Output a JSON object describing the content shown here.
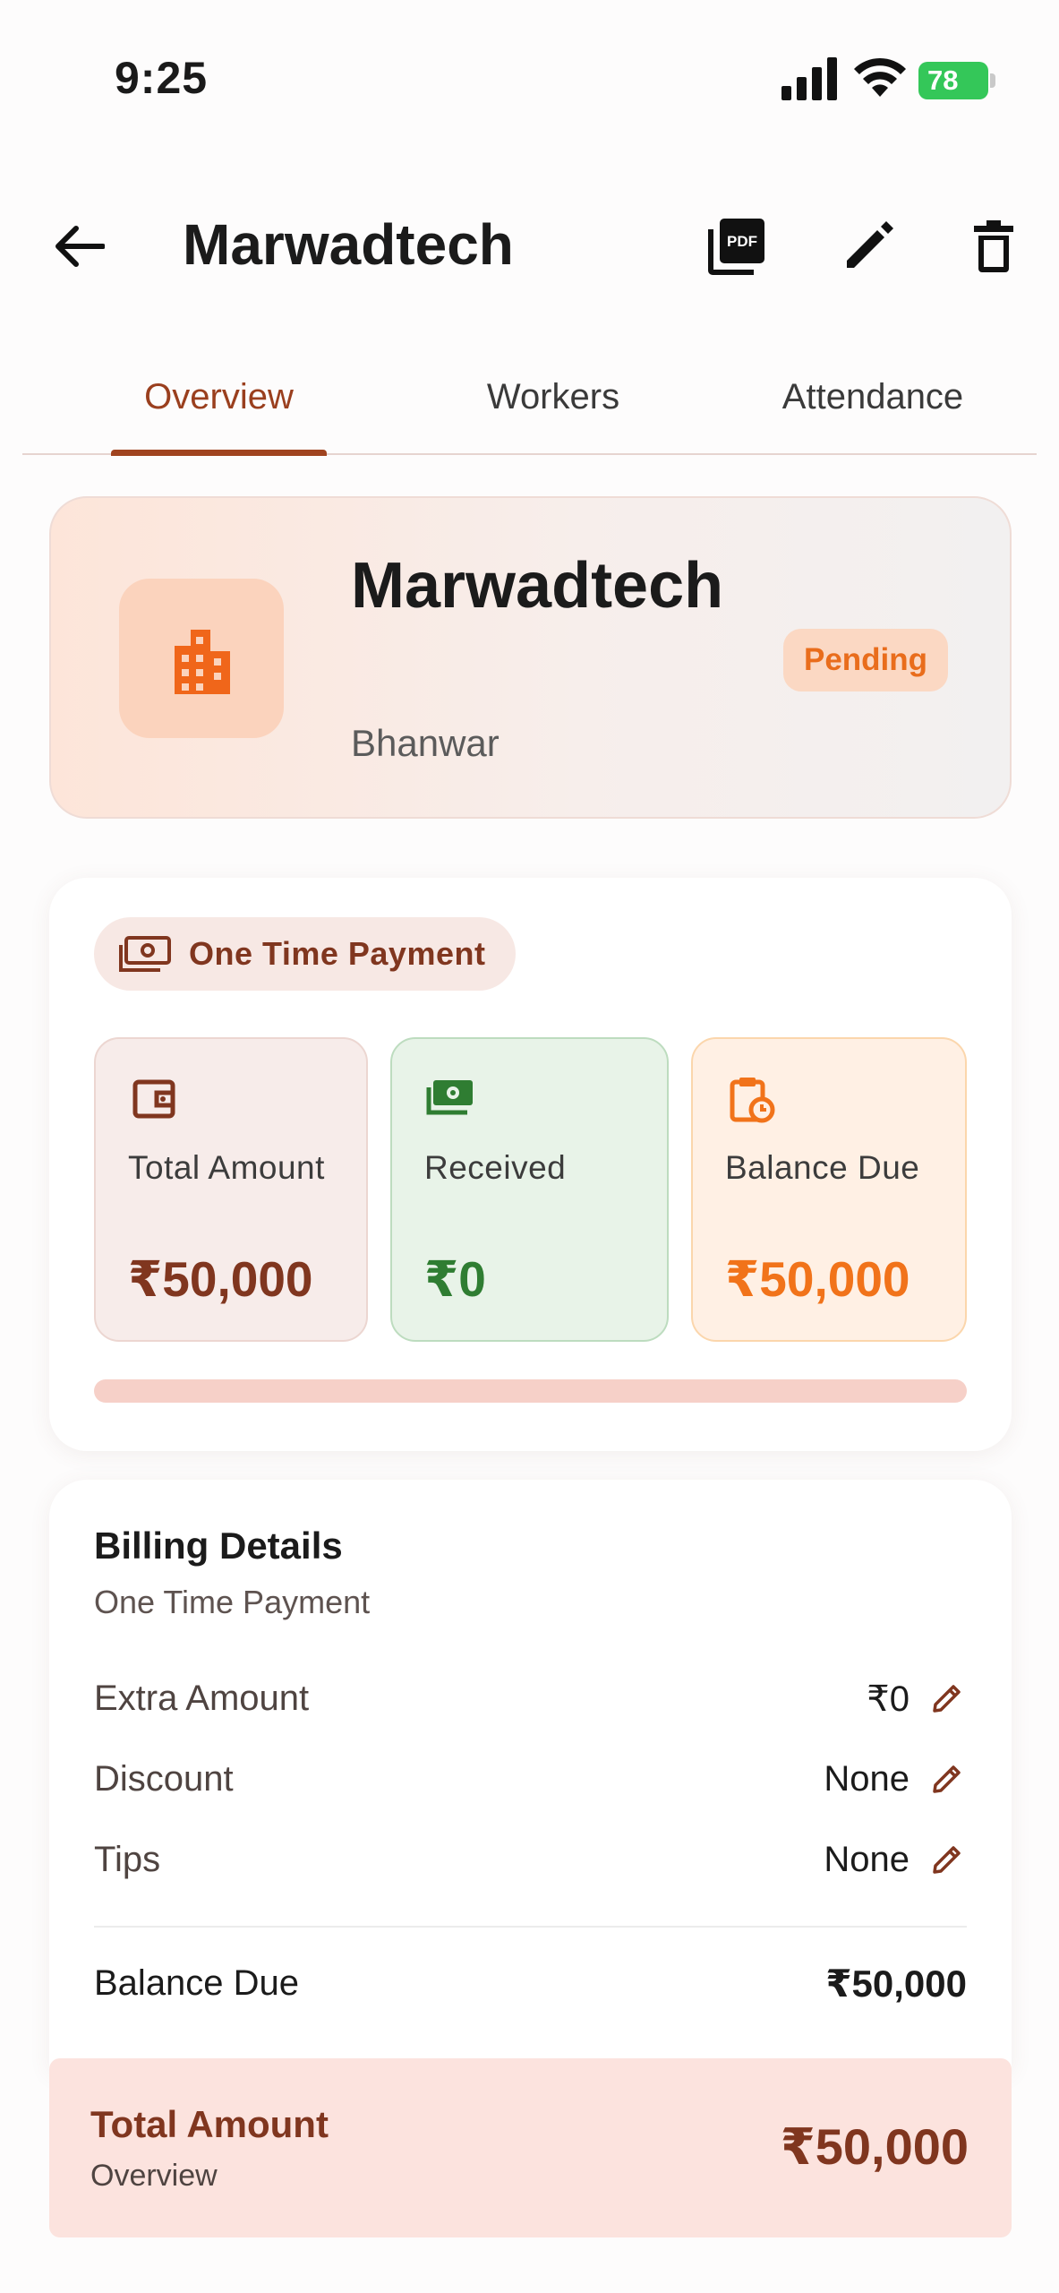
{
  "status_bar": {
    "time": "9:25",
    "battery": "78",
    "icons": [
      "signal-icon",
      "wifi-icon",
      "battery-icon"
    ]
  },
  "app_bar": {
    "title": "Marwadtech",
    "pdf_icon_label": "PDF",
    "icons": [
      "back-arrow-icon",
      "pdf-icon",
      "edit-icon",
      "delete-icon"
    ]
  },
  "tabs": [
    {
      "label": "Overview",
      "active": true
    },
    {
      "label": "Workers",
      "active": false
    },
    {
      "label": "Attendance",
      "active": false
    }
  ],
  "project": {
    "name": "Marwadtech",
    "client": "Bhanwar",
    "status": "Pending",
    "icon": "building-icon"
  },
  "payment": {
    "type": "One Time Payment",
    "total": {
      "label": "Total Amount",
      "value": "₹50,000",
      "icon": "wallet-icon"
    },
    "received": {
      "label": "Received",
      "value": "₹0",
      "icon": "cash-icon"
    },
    "balance": {
      "label": "Balance Due",
      "value": "₹50,000",
      "icon": "clipboard-clock-icon"
    },
    "progress_fraction": 0
  },
  "billing": {
    "title": "Billing Details",
    "subtitle": "One Time Payment",
    "rows": [
      {
        "label": "Extra Amount",
        "value": "₹0"
      },
      {
        "label": "Discount",
        "value": "None"
      },
      {
        "label": "Tips",
        "value": "None"
      }
    ],
    "balance_due_label": "Balance Due",
    "balance_due_value": "₹50,000"
  },
  "summary": {
    "title": "Total Amount",
    "subtitle": "Overview",
    "value": "₹50,000"
  },
  "colors": {
    "accent": "#9a3f1e",
    "pending": "#e96d1c",
    "received": "#2f7d32",
    "balance": "#f1731a"
  }
}
